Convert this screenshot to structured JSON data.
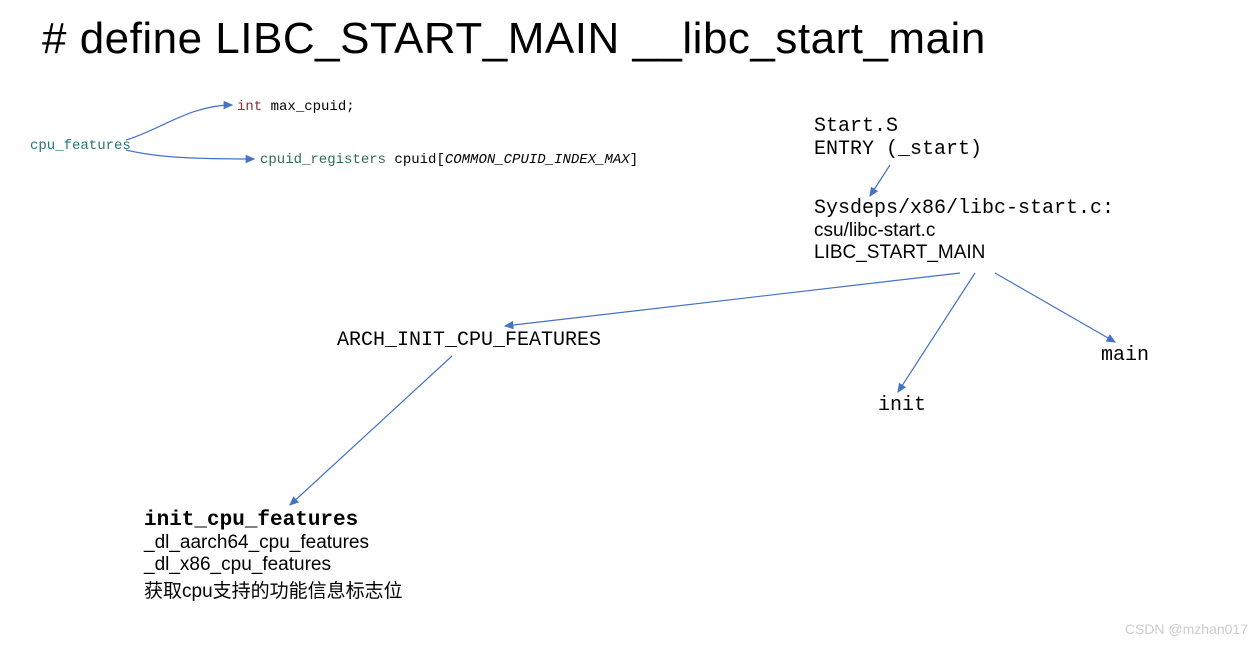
{
  "title": "# define LIBC_START_MAIN __libc_start_main",
  "left_struct": {
    "root": "cpu_features",
    "int_kw": "int",
    "max_cpuid": "max_cpuid",
    "semicolon": ";",
    "struct_name": "cpuid_registers",
    "after_struct": " cpuid[",
    "ital_part": "COMMON_CPUID_INDEX_MAX",
    "close_bracket": "]"
  },
  "start": {
    "line1": "Start.S",
    "line2": "ENTRY (_start)"
  },
  "sysdeps": {
    "line1": "Sysdeps/x86/libc-start.c:",
    "line2": "csu/libc-start.c",
    "line3": "LIBC_START_MAIN"
  },
  "arch": "ARCH_INIT_CPU_FEATURES",
  "init": "init",
  "main": "main",
  "init_cpu": {
    "title": "init_cpu_features",
    "l1": "_dl_aarch64_cpu_features",
    "l2": "_dl_x86_cpu_features",
    "l3": "获取cpu支持的功能信息标志位"
  },
  "watermark": "CSDN @mzhan017"
}
